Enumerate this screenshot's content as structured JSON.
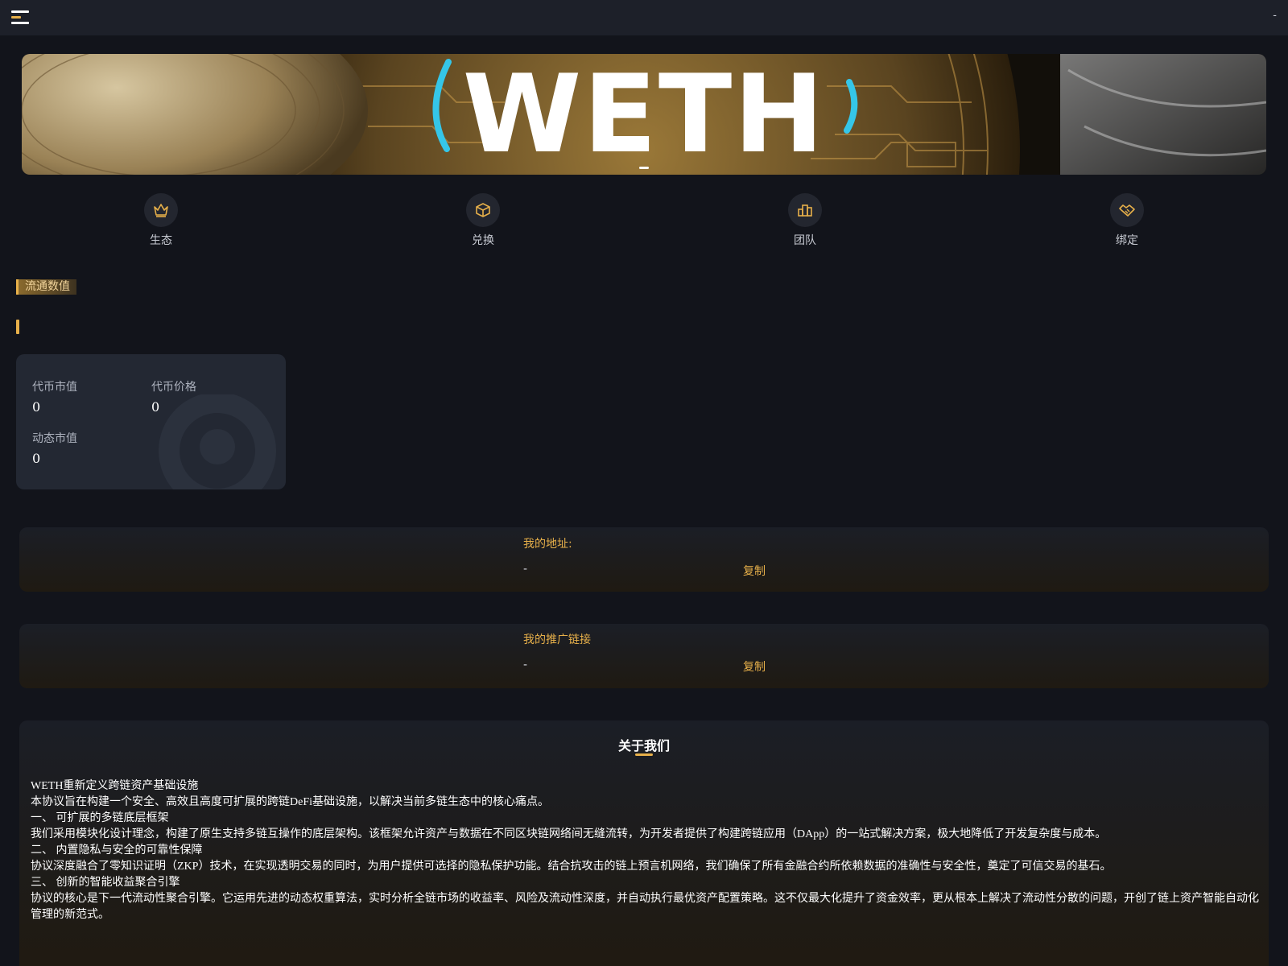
{
  "header": {
    "menu_icon": "menu-icon",
    "right_text": "-"
  },
  "banner": {
    "text": "WETH",
    "slide_count": 1,
    "active_slide": 1
  },
  "nav": {
    "items": [
      {
        "label": "生态",
        "icon": "crown-icon"
      },
      {
        "label": "兑换",
        "icon": "cube-icon"
      },
      {
        "label": "团队",
        "icon": "podium-icon"
      },
      {
        "label": "绑定",
        "icon": "handshake-icon"
      }
    ]
  },
  "circulation": {
    "section_title": "流通数值",
    "stats": [
      {
        "label": "代币市值",
        "value": "0"
      },
      {
        "label": "代币价格",
        "value": "0"
      },
      {
        "label": "动态市值",
        "value": "0"
      }
    ]
  },
  "address": {
    "title": "我的地址:",
    "value": "-",
    "copy_label": "复制"
  },
  "referral": {
    "title": "我的推广链接",
    "value": "-",
    "copy_label": "复制"
  },
  "about": {
    "title": "关于我们",
    "lines": [
      "WETH重新定义跨链资产基础设施",
      "本协议旨在构建一个安全、高效且高度可扩展的跨链DeFi基础设施，以解决当前多链生态中的核心痛点。",
      "一、 可扩展的多链底层框架",
      "我们采用模块化设计理念，构建了原生支持多链互操作的底层架构。该框架允许资产与数据在不同区块链网络间无缝流转，为开发者提供了构建跨链应用（DApp）的一站式解决方案，极大地降低了开发复杂度与成本。",
      "二、 内置隐私与安全的可靠性保障",
      "协议深度融合了零知识证明（ZKP）技术，在实现透明交易的同时，为用户提供可选择的隐私保护功能。结合抗攻击的链上预言机网络，我们确保了所有金融合约所依赖数据的准确性与安全性，奠定了可信交易的基石。",
      "三、 创新的智能收益聚合引擎",
      "协议的核心是下一代流动性聚合引擎。它运用先进的动态权重算法，实时分析全链市场的收益率、风险及流动性深度，并自动执行最优资产配置策略。这不仅最大化提升了资金效率，更从根本上解决了流动性分散的问题，开创了链上资产智能自动化管理的新范式。"
    ]
  },
  "colors": {
    "background": "#12141b",
    "accent": "#e7b04a",
    "card": "#232833"
  }
}
